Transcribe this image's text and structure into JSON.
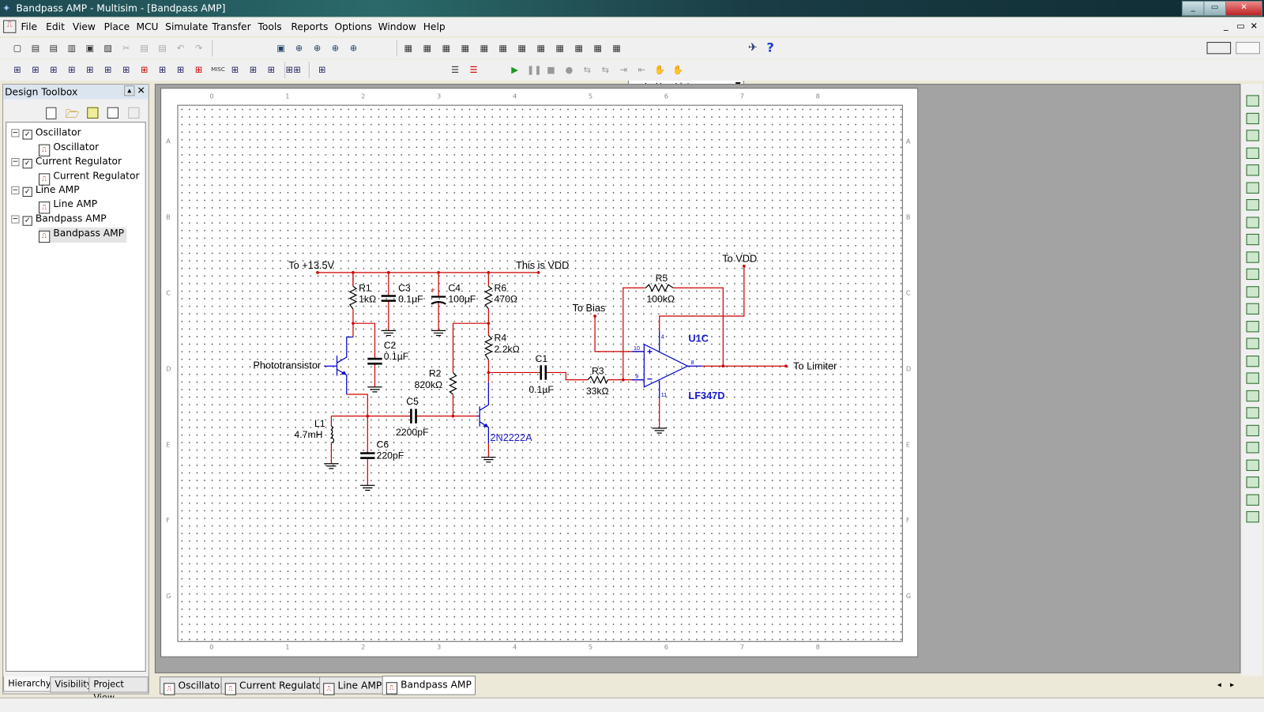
{
  "window": {
    "title": "Bandpass AMP - Multisim - [Bandpass AMP]",
    "controls": [
      "_",
      "▭",
      "✕"
    ],
    "child_controls": [
      "_",
      "▭",
      "✕"
    ]
  },
  "menu": [
    "File",
    "Edit",
    "View",
    "Place",
    "MCU",
    "Simulate",
    "Transfer",
    "Tools",
    "Reports",
    "Options",
    "Window",
    "Help"
  ],
  "toolbar1": {
    "file_icons": [
      "new-icon",
      "open-folder-icon",
      "open-icon",
      "save-icon",
      "print-icon",
      "print-preview-icon",
      "cut-icon",
      "copy-icon",
      "paste-icon",
      "undo-icon",
      "redo-icon"
    ],
    "zoom_icons": [
      "zoom-area-icon",
      "zoom-in-icon",
      "zoom-out-icon",
      "zoom-fit-icon",
      "zoom-full-icon"
    ],
    "view_icons": [
      "hierarchy-icon",
      "spreadsheet-icon",
      "database-icon",
      "grapher-icon",
      "postprocessor-icon",
      "analyzer-icon",
      "breadboard-icon",
      "ercheck-icon",
      "select-icon",
      "copy-area-icon",
      "back-annotate-icon",
      "forward-annotate-icon"
    ],
    "in_use_list": "--- In Use List ---",
    "help_label": "?"
  },
  "toolbar2": {
    "component_icons": [
      "source-icon",
      "resistor-icon",
      "diode-icon",
      "transistor-icon",
      "analog-icon",
      "ttl-icon",
      "cmos-icon",
      "mcu-icon",
      "mixed-icon",
      "indicator-icon",
      "power-icon",
      "misc-label",
      "advanced-periph-icon",
      "rf-icon",
      "electromech-icon",
      "ladder-icon",
      "hier-block-icon",
      "bus-icon"
    ],
    "misc_label": "MISC",
    "sim_icons": [
      "run-icon",
      "pause-icon",
      "stop-icon",
      "probe-icon",
      "step-icon",
      "step-into-icon",
      "step-over-icon",
      "step-out-icon",
      "toggle-breakpoint-icon",
      "remove-breakpoint-icon"
    ]
  },
  "toolbox": {
    "title": "Design Toolbox",
    "tree": [
      {
        "label": "Oscillator",
        "child": "Oscillator"
      },
      {
        "label": "Current Regulator",
        "child": "Current Regulator"
      },
      {
        "label": "Line AMP",
        "child": "Line AMP"
      },
      {
        "label": "Bandpass AMP",
        "child": "Bandpass AMP"
      }
    ],
    "tabs": [
      "Hierarchy",
      "Visibility",
      "Project View"
    ]
  },
  "sheet": {
    "cols": [
      "0",
      "1",
      "2",
      "3",
      "4",
      "5",
      "6",
      "7",
      "8"
    ],
    "rows": [
      "A",
      "B",
      "C",
      "D",
      "E",
      "F",
      "G"
    ]
  },
  "schematic": {
    "labels": {
      "vcc": "To +13.5V",
      "vdd_note": "This is VDD",
      "to_vdd": "To VDD",
      "to_bias": "To Bias",
      "to_limiter": "To Limiter",
      "phototransistor": "Phototransistor"
    },
    "R1": {
      "ref": "R1",
      "value": "1kΩ"
    },
    "R2": {
      "ref": "R2",
      "value": "820kΩ"
    },
    "R3": {
      "ref": "R3",
      "value": "33kΩ"
    },
    "R4": {
      "ref": "R4",
      "value": "2.2kΩ"
    },
    "R5": {
      "ref": "R5",
      "value": "100kΩ"
    },
    "R6": {
      "ref": "R6",
      "value": "470Ω"
    },
    "C1": {
      "ref": "C1",
      "value": "0.1µF"
    },
    "C2": {
      "ref": "C2",
      "value": "0.1µF"
    },
    "C3": {
      "ref": "C3",
      "value": "0.1µF"
    },
    "C4": {
      "ref": "C4",
      "value": "100µF"
    },
    "C5": {
      "ref": "C5",
      "value": "2200pF"
    },
    "C6": {
      "ref": "C6",
      "value": "220pF"
    },
    "L1": {
      "ref": "L1",
      "value": "4.7mH"
    },
    "Q": {
      "model": "2N2222A"
    },
    "U1": {
      "ref": "U1C",
      "model": "LF347D",
      "pins": {
        "plus": "10",
        "minus": "9",
        "out": "8",
        "vplus": "4",
        "vminus": "11"
      }
    },
    "c4_polarity": "+"
  },
  "tabs": [
    "Oscillator",
    "Current Regulator",
    "Line AMP",
    "Bandpass AMP"
  ],
  "active_tab": "Bandpass AMP",
  "colors": {
    "wire": "#cc0000",
    "component": "#0000cc",
    "label_blue": "#1a1acc"
  }
}
